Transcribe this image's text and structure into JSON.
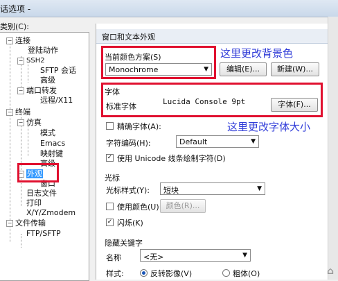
{
  "window": {
    "title": "话选项 -"
  },
  "category_label": "类别(C):",
  "tree": {
    "connect": "连接",
    "login_actions": "登陆动作",
    "ssh2": "SSH2",
    "sftp_session": "SFTP 会话",
    "ssh2_advanced": "高级",
    "port_forwarding": "端口转发",
    "remote_x11": "远程/X11",
    "terminal": "终端",
    "emulation": "仿真",
    "modes": "模式",
    "emacs": "Emacs",
    "mapped_keys": "映射键",
    "emu_advanced": "高级",
    "appearance": "外观",
    "window": "窗口",
    "log_file": "日志文件",
    "print": "打印",
    "xyzmodem": "X/Y/Zmodem",
    "file_transfer": "文件传输",
    "ftp_sftp": "FTP/SFTP"
  },
  "panel": {
    "section_title": "窗口和文本外观",
    "color_scheme_label": "当前颜色方案(S)",
    "color_scheme_value": "Monochrome",
    "edit_button": "编辑(E)...",
    "new_button": "新建(W)...",
    "font_group": "字体",
    "standard_font_label": "标准字体",
    "standard_font_value": "Lucida Console 9pt",
    "font_button": "字体(F)...",
    "precise_font": "精确字体(A):",
    "char_encoding_label": "字符编码(H):",
    "char_encoding_value": "Default",
    "unicode_line_drawing": "使用 Unicode 线条绘制字符(D)",
    "cursor_group": "光标",
    "cursor_style_label": "光标样式(Y):",
    "cursor_style_value": "短块",
    "use_color": "使用颜色(U):",
    "color_button": "颜色(R)...",
    "blink": "闪烁(K)",
    "hidden_keyword_group": "隐藏关键字",
    "name_label": "名称",
    "name_value": "<无>",
    "style_label": "样式:",
    "reverse_video": "反转影像(V)",
    "bold": "粗体(O)"
  },
  "annotations": {
    "background_note": "这里更改背景色",
    "font_note": "这里更改字体大小"
  },
  "colors": {
    "highlight": "#e0102f",
    "annotation": "#2f3bd8",
    "selection": "#3399ff"
  }
}
